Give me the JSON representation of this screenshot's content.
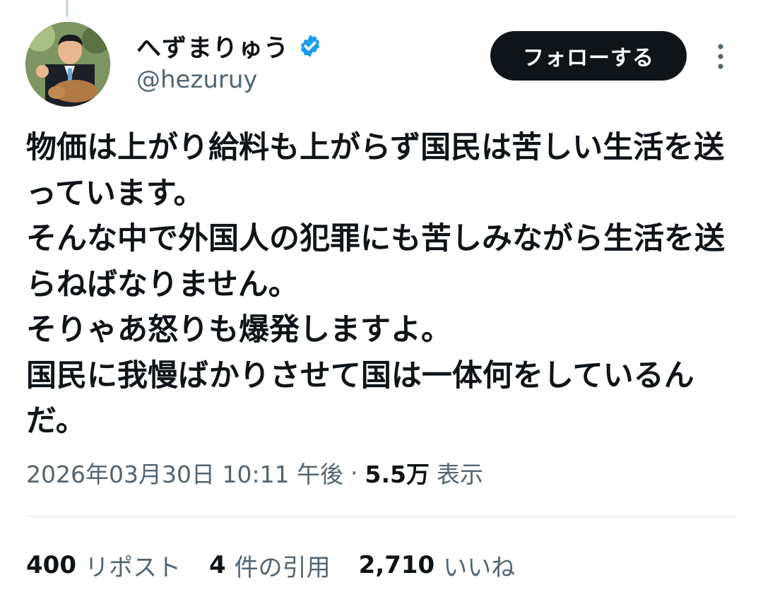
{
  "tweet": {
    "author": {
      "display_name": "へずまりゅう",
      "handle": "@hezuruy",
      "verified": true,
      "verified_color": "#1d9bf0"
    },
    "follow_button_label": "フォローする",
    "text": "物価は上がり給料も上がらず国民は苦しい生活を送っています。\nそんな中で外国人の犯罪にも苦しみながら生活を送らねばなりません。\nそりゃあ怒りも爆発しますよ。\n国民に我慢ばかりさせて国は一体何をしているんだ。",
    "timestamp": "2026年03月30日 10:11 午後",
    "separator": "·",
    "views_count": "5.5万",
    "views_label": "表示",
    "stats": [
      {
        "value": "400",
        "label": "リポスト"
      },
      {
        "value": "4",
        "label": "件の引用"
      },
      {
        "value": "2,710",
        "label": "いいね"
      }
    ]
  },
  "icons": {
    "verified": "verified-badge-icon",
    "more": "more-vertical-icon"
  },
  "colors": {
    "text_primary": "#0f1419",
    "text_secondary": "#536471",
    "follow_button_bg": "#0f1419",
    "divider": "#eff3f4"
  }
}
